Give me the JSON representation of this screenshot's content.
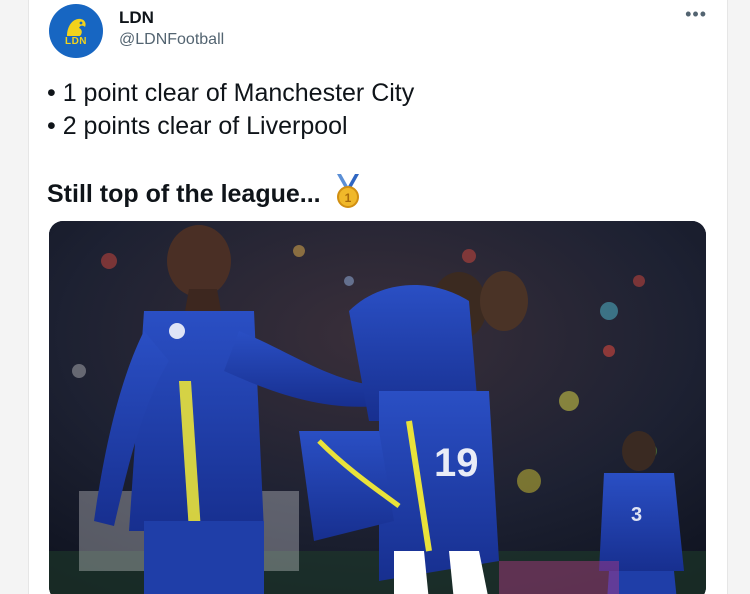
{
  "tweet": {
    "author_name": "LDN",
    "author_handle": "@LDNFootball",
    "avatar_text": "LDN",
    "more_label": "•••",
    "bullets": [
      "• 1 point clear of Manchester City",
      "• 2 points clear of Liverpool"
    ],
    "headline": "Still top of the league...",
    "medal_icon": "gold-medal-icon",
    "photo_icon": "football-celebration-photo"
  },
  "colors": {
    "avatar_bg": "#1766c2",
    "avatar_accent": "#f2d21c",
    "handle": "#536471",
    "kit_blue": "#1f3ea8",
    "kit_accent": "#e9e23a"
  }
}
